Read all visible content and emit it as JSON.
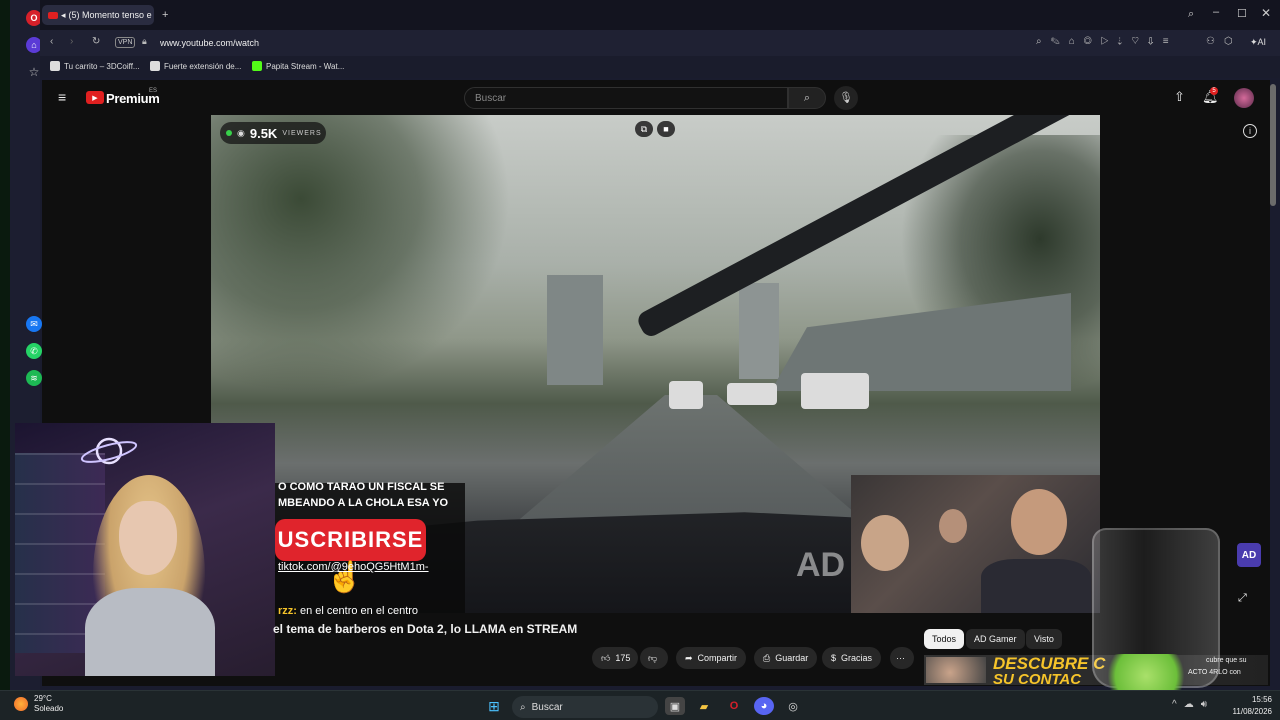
{
  "browser": {
    "tab_title": "(5) Momento tenso e",
    "url": "www.youtube.com/watch",
    "vpn_label": "VPN",
    "ai_label": "AI",
    "bookmarks": [
      {
        "label": "Tu carrito – 3DCoiff..."
      },
      {
        "label": "Fuerte extensión de..."
      },
      {
        "label": "Papita Stream - Wat..."
      }
    ]
  },
  "youtube": {
    "brand": "Premium",
    "region": "ES",
    "search_placeholder": "Buscar",
    "notification_count": "5"
  },
  "video": {
    "viewers": "9.5K",
    "viewers_label": "VIEWERS",
    "watermark": "AD",
    "title": "el tema de barberos en Dota 2, lo LLAMA en STREAM"
  },
  "overlay": {
    "line1": "O COMO TARAO UN FISCAL SE",
    "line2": "MBEANDO A LA CHOLA ESA YO",
    "subscribe": "USCRIBIRSE",
    "tiktok": "tiktok.com/@9ehoQG5HtM1m-",
    "chat_user": "rzz:",
    "chat_text": "en el centro en el centro"
  },
  "actions": {
    "likes": "175",
    "share": "Compartir",
    "save": "Guardar",
    "thanks": "Gracias",
    "more": "···"
  },
  "chips": [
    {
      "label": "Todos"
    },
    {
      "label": "AD Gamer"
    },
    {
      "label": "Visto"
    }
  ],
  "promo": {
    "line1": "DESCUBRE C",
    "line2": "SU CONTAC",
    "side1": "cubre que su",
    "side2": "ACTO 4RLO con",
    "badge": "AD"
  },
  "taskbar": {
    "temperature": "29°C",
    "weather": "Soleado",
    "search": "Buscar",
    "time": "15:56",
    "date": "11/08/2026"
  },
  "colors": {
    "youtube_red": "#e02020",
    "subscribe_red": "#e0242c",
    "promo_yellow": "#f6c42a",
    "live_green": "#38d14a",
    "opera_red": "#d6202a"
  },
  "icons": {
    "menu": "hamburger-icon",
    "search": "search-icon",
    "mic": "mic-icon",
    "upload": "upload-icon",
    "bell": "bell-icon",
    "info": "info-icon",
    "fullscreen": "fullscreen-icon"
  }
}
